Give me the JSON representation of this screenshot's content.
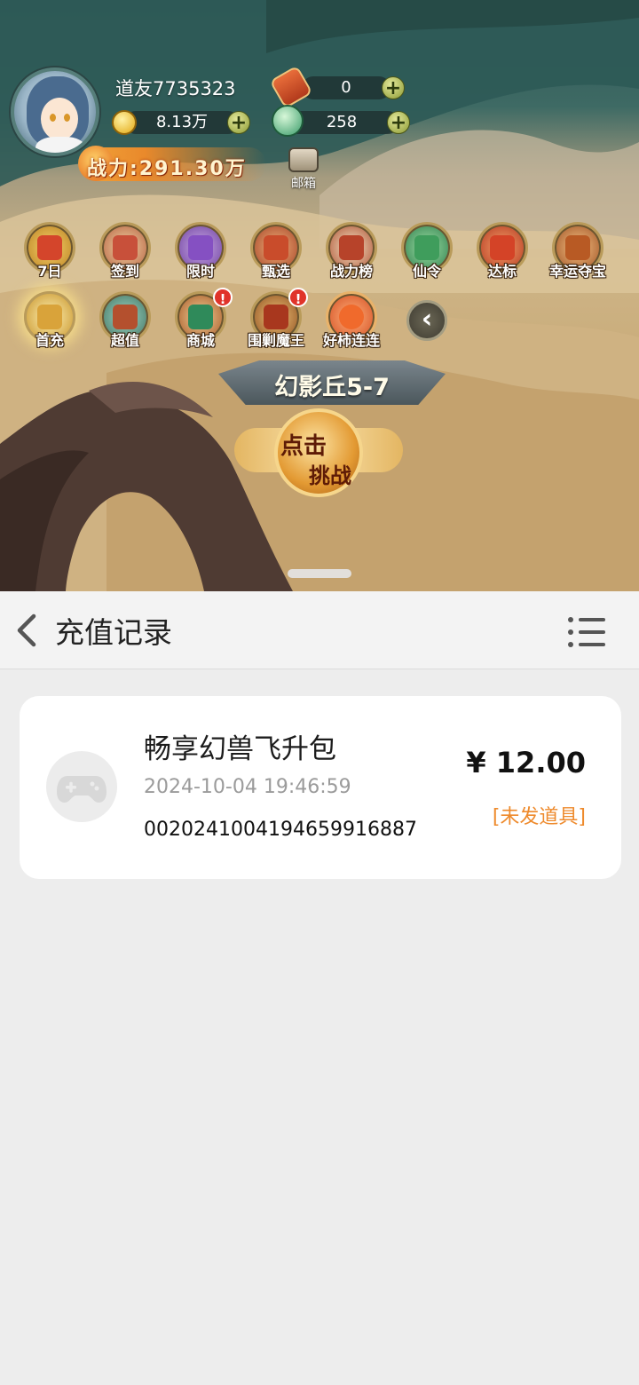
{
  "game": {
    "username": "道友7735323",
    "coins": "8.13万",
    "tickets": "0",
    "jade": "258",
    "power": "战力:291.30万",
    "mail_label": "邮箱",
    "activities_row1": [
      "7日",
      "签到",
      "限时",
      "甄选",
      "战力榜",
      "仙令",
      "达标",
      "幸运夺宝"
    ],
    "activities_row2": [
      "首充",
      "超值",
      "商城",
      "围剿魔王",
      "好柿连连"
    ],
    "badge": "!",
    "stage": "幻影丘5-7",
    "challenge_line1": "点击",
    "challenge_line2": "挑战"
  },
  "panel": {
    "title": "充值记录",
    "record": {
      "name": "畅享幻兽飞升包",
      "time": "2024-10-04 19:46:59",
      "order_no": "0020241004194659916887",
      "price": "¥ 12.00",
      "status": "[未发道具]"
    }
  },
  "colors": {
    "status": "#ee8a2c",
    "panel_bg": "#ededed",
    "card_bg": "#ffffff"
  },
  "icons": [
    "back-icon",
    "menu-list-icon",
    "gamepad-icon",
    "coin-icon",
    "ticket-icon",
    "jade-icon",
    "mail-icon"
  ]
}
